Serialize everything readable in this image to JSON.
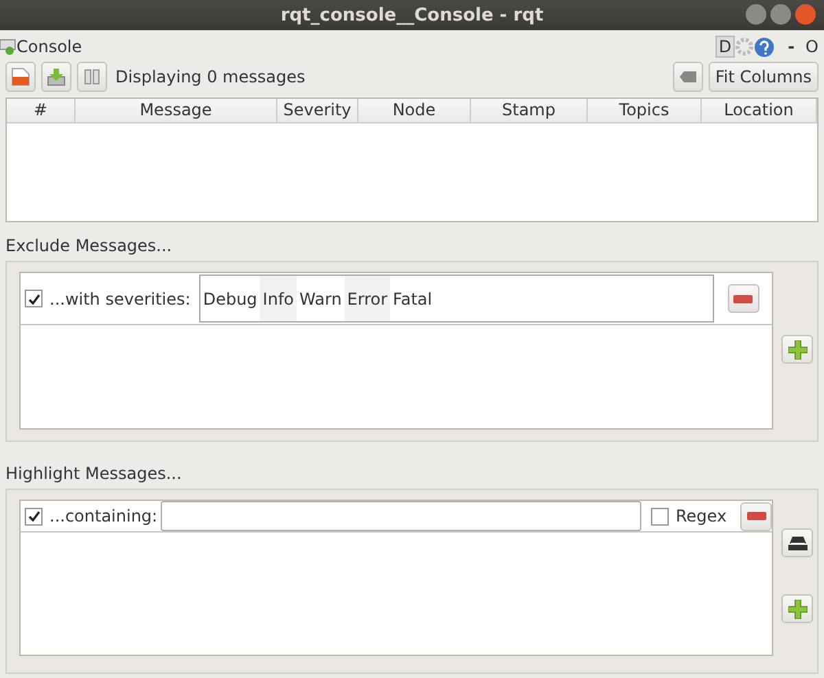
{
  "window": {
    "title": "rqt_console__Console - rqt"
  },
  "plugin": {
    "title": "Console",
    "d_label": "D",
    "minimize": "-",
    "close": "O"
  },
  "toolbar": {
    "status": "Displaying 0 messages",
    "fit_button": "Fit Columns"
  },
  "table": {
    "columns": [
      "#",
      "Message",
      "Severity",
      "Node",
      "Stamp",
      "Topics",
      "Location"
    ]
  },
  "exclude": {
    "title": "Exclude Messages...",
    "filters": [
      {
        "checked": true,
        "label": "...with severities:",
        "severities": [
          "Debug",
          "Info",
          "Warn",
          "Error",
          "Fatal"
        ]
      }
    ]
  },
  "highlight": {
    "title": "Highlight Messages...",
    "filters": [
      {
        "checked": true,
        "label": "...containing:",
        "regex_label": "Regex",
        "regex": false
      }
    ]
  }
}
